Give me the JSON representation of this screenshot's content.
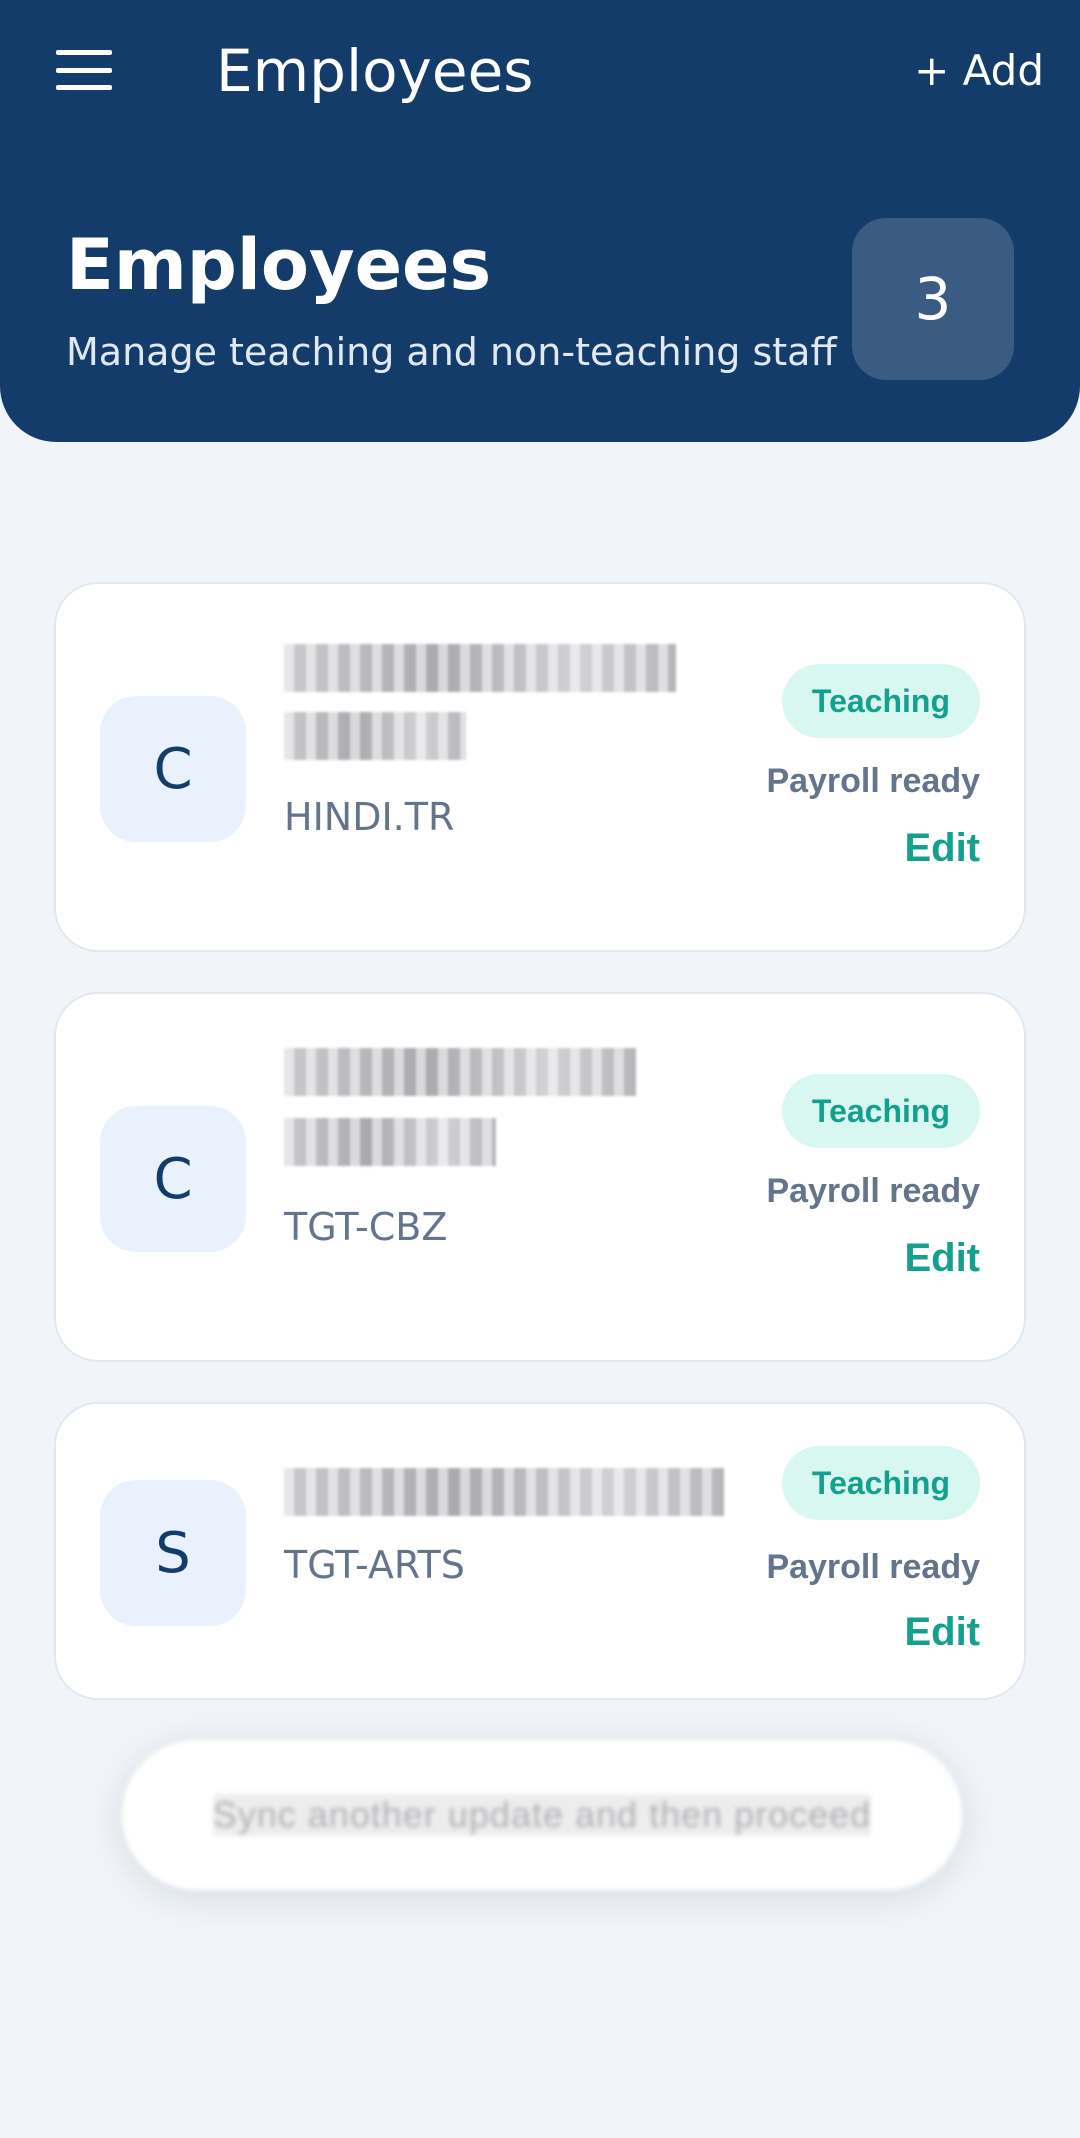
{
  "appbar": {
    "title": "Employees",
    "add_label": "+ Add",
    "menu_icon": "hamburger-menu-icon"
  },
  "hero": {
    "title": "Employees",
    "subtitle": "Manage teaching and non-teaching staff",
    "count": "3"
  },
  "employees": [
    {
      "initial": "C",
      "name": "CHANDRAKANTI PANDE",
      "department": "HINDI.TR",
      "type": "Teaching",
      "status": "Payroll ready",
      "edit_label": "Edit"
    },
    {
      "initial": "C",
      "name": "CHHAYA DEVI KUMARI",
      "department": "TGT-CBZ",
      "type": "Teaching",
      "status": "Payroll ready",
      "edit_label": "Edit"
    },
    {
      "initial": "S",
      "name": "SUMITRA KUMARI",
      "department": "TGT-ARTS",
      "type": "Teaching",
      "status": "Payroll ready",
      "edit_label": "Edit"
    }
  ],
  "toast": {
    "message": "Sync another update and then proceed"
  },
  "colors": {
    "primary": "#143c6b",
    "accent": "#14a08e",
    "background": "#f1f5f9",
    "badge_bg": "#d8f7f0",
    "avatar_bg": "#e9f1fd"
  }
}
